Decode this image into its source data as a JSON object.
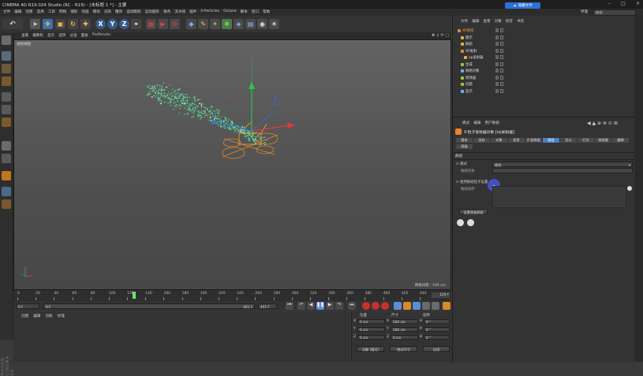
{
  "window": {
    "title": "CINEMA 4D R19.024 Studio (RC - R19) - [未标题 1 *] - 主要",
    "cloud_button": "隐藏文件",
    "controls": [
      "–",
      "□",
      "×"
    ]
  },
  "menubar": {
    "items": [
      "文件",
      "编辑",
      "创建",
      "选择",
      "工具",
      "网格",
      "捕捉",
      "动画",
      "模拟",
      "渲染",
      "雕刻",
      "运动跟踪",
      "运动图形",
      "角色",
      "流水线",
      "插件",
      "X-Particles",
      "Octane",
      "脚本",
      "窗口",
      "帮助"
    ],
    "layout_label": "界面",
    "layout_value": "启动"
  },
  "viewport": {
    "menu": [
      "查看",
      "摄像机",
      "显示",
      "选项",
      "过滤",
      "面板",
      "ProRender"
    ],
    "label": "透视视图",
    "grid_info": "网格间距 : 100 cm"
  },
  "timeline": {
    "ticks": [
      "0",
      "20",
      "40",
      "60",
      "80",
      "100",
      "120",
      "140",
      "160",
      "180",
      "200",
      "220",
      "240",
      "260",
      "280",
      "300",
      "320",
      "340",
      "360",
      "380",
      "400",
      "420",
      "440"
    ],
    "frame_out": "129 F",
    "current_frame": "129"
  },
  "transport": {
    "start": "0 F",
    "slider_start": "0 F",
    "slider_end": "451 F",
    "end": "451 F"
  },
  "materials": {
    "menu": [
      "创建",
      "编辑",
      "功能",
      "纹理"
    ]
  },
  "coordinates": {
    "headers": [
      "位置",
      "尺寸",
      "旋转"
    ],
    "rows": [
      {
        "axis": "X",
        "pos": "0 cm",
        "size": "100 cm",
        "rot_label": "H",
        "rot": "0 °"
      },
      {
        "axis": "Y",
        "pos": "0 cm",
        "size": "100 cm",
        "rot_label": "P",
        "rot": "0 °"
      },
      {
        "axis": "Z",
        "pos": "0 cm",
        "size": "0 cm",
        "rot_label": "B",
        "rot": "0 °"
      }
    ],
    "mode": "对象 (相对)",
    "size_mode": "绝对尺寸",
    "apply": "应用"
  },
  "object_manager": {
    "menu": [
      "文件",
      "编辑",
      "查看",
      "对象",
      "标签",
      "书签"
    ],
    "objects": [
      {
        "name": "XP系统",
        "color": "#e08a3a",
        "indent": 0
      },
      {
        "name": "图示",
        "color": "#e0b040",
        "indent": 1
      },
      {
        "name": "群组",
        "color": "#e0b040",
        "indent": 1
      },
      {
        "name": "XP发射",
        "color": "#e08a3a",
        "indent": 1
      },
      {
        "name": "xp发射器",
        "color": "#e0b040",
        "indent": 2
      },
      {
        "name": "生成",
        "color": "#9cc63a",
        "indent": 1
      },
      {
        "name": "网格对象",
        "color": "#6bb4e6",
        "indent": 1
      },
      {
        "name": "修改器",
        "color": "#9cc63a",
        "indent": 1
      },
      {
        "name": "问题",
        "color": "#9cc63a",
        "indent": 1
      },
      {
        "name": "显示",
        "color": "#6bb4e6",
        "indent": 1
      }
    ]
  },
  "attribute_manager": {
    "menu": [
      "模式",
      "编辑",
      "用户数据"
    ],
    "title": "X-粒子发射器对象 [xp发射器]",
    "tabs_row1": [
      "基本",
      "坐标",
      "对象",
      "发射",
      "扩展数据",
      "群组",
      "显示",
      "灯光",
      "修改器",
      "编辑"
    ],
    "tabs_row2": [
      "高级"
    ],
    "active_tab": "群组",
    "section": "群组",
    "mode_label": "模式",
    "mode_value": "随机",
    "group_label": "群组列表",
    "use_label": "使用群组粒子设置",
    "list_label": "群组排序",
    "button": "设置改变群组"
  },
  "colors": {
    "accent": "#4a7fc0",
    "particles": "#4fd68b",
    "emitter": "#e8842a",
    "axis_y": "#2fc24a",
    "axis_x": "#e23a3a",
    "axis_z": "#3a6fe2"
  }
}
